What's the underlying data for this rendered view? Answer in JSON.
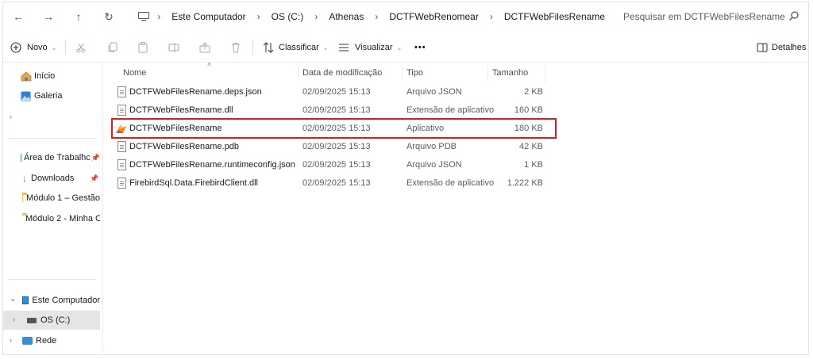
{
  "breadcrumb": [
    "Este Computador",
    "OS (C:)",
    "Athenas",
    "DCTFWebRenomear",
    "DCTFWebFilesRename"
  ],
  "search": {
    "placeholder": "Pesquisar em DCTFWebFilesRename"
  },
  "toolbar": {
    "new_label": "Novo",
    "sort_label": "Classificar",
    "view_label": "Visualizar",
    "more_label": "•••",
    "details_label": "Detalhes"
  },
  "nav": {
    "home": "Início",
    "gallery": "Galeria",
    "desktop": "Área de Trabalhc",
    "downloads": "Downloads",
    "folder1": "Módulo 1 – Gestão",
    "folder2": "Módulo 2 - Minha C",
    "this_pc": "Este Computador",
    "drive_c": "OS (C:)",
    "network": "Rede"
  },
  "columns": {
    "name": "Nome",
    "date": "Data de modificação",
    "type": "Tipo",
    "size": "Tamanho"
  },
  "files": [
    {
      "name": "DCTFWebFilesRename.deps.json",
      "date": "02/09/2025 15:13",
      "type": "Arquivo JSON",
      "size": "2 KB",
      "icon": "file-icon"
    },
    {
      "name": "DCTFWebFilesRename.dll",
      "date": "02/09/2025 15:13",
      "type": "Extensão de aplicativo",
      "size": "160 KB",
      "icon": "dll-icon"
    },
    {
      "name": "DCTFWebFilesRename",
      "date": "02/09/2025 15:13",
      "type": "Aplicativo",
      "size": "180 KB",
      "icon": "app-icon"
    },
    {
      "name": "DCTFWebFilesRename.pdb",
      "date": "02/09/2025 15:13",
      "type": "Arquivo PDB",
      "size": "42 KB",
      "icon": "file-icon"
    },
    {
      "name": "DCTFWebFilesRename.runtimeconfig.json",
      "date": "02/09/2025 15:13",
      "type": "Arquivo JSON",
      "size": "1 KB",
      "icon": "file-icon"
    },
    {
      "name": "FirebirdSql.Data.FirebirdClient.dll",
      "date": "02/09/2025 15:13",
      "type": "Extensão de aplicativo",
      "size": "1.222 KB",
      "icon": "dll-icon"
    }
  ],
  "colors": {
    "highlight": "#e31b1b",
    "selected_nav": "#e5e5e5",
    "folder": "#f3c13a"
  }
}
